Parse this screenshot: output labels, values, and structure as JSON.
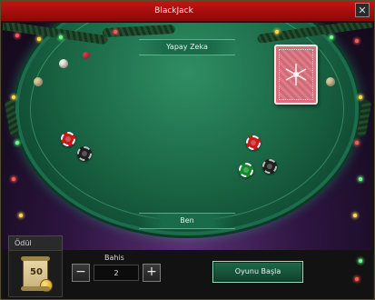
{
  "window": {
    "title": "BlackJack",
    "close_icon": "close-icon"
  },
  "table": {
    "dealer_label": "Yapay Zeka",
    "player_label": "Ben",
    "felt_color": "#1c6a48",
    "backdrop_color": "#2d1540",
    "card_back_color": "#d9707d"
  },
  "chips": {
    "dealer_side": [
      "red",
      "black"
    ],
    "player_side": [
      "red",
      "green",
      "black"
    ]
  },
  "reward": {
    "label": "Ödül",
    "value": "50"
  },
  "bet": {
    "label": "Bahis",
    "value": "2",
    "minus_icon": "minus-icon",
    "plus_icon": "plus-icon"
  },
  "actions": {
    "start_label": "Oyunu Başla"
  }
}
